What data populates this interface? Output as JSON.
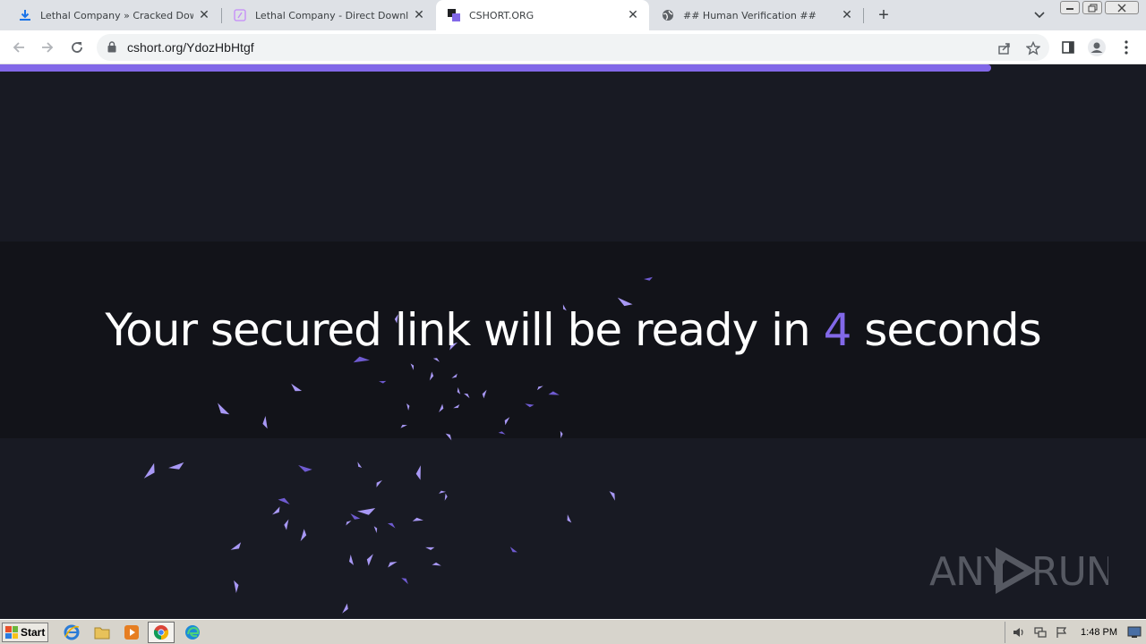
{
  "browser": {
    "tabs": [
      {
        "title": "Lethal Company » Cracked Download",
        "icon": "download-icon",
        "active": false
      },
      {
        "title": "Lethal Company - Direct Download (F",
        "icon": "page-icon",
        "active": false
      },
      {
        "title": "CSHORT.ORG",
        "icon": "cshort-icon",
        "active": true
      },
      {
        "title": "## Human Verification ##",
        "icon": "globe-icon",
        "active": false
      }
    ],
    "url": "cshort.org/YdozHbHtgf"
  },
  "page": {
    "headline_before": "Your secured link will be ready in ",
    "countdown": "4",
    "headline_after": " seconds",
    "progress_fraction": 0.865,
    "accent_color": "#8268e8",
    "watermark": "ANY RUN"
  },
  "taskbar": {
    "start_label": "Start",
    "clock": "1:48 PM"
  }
}
